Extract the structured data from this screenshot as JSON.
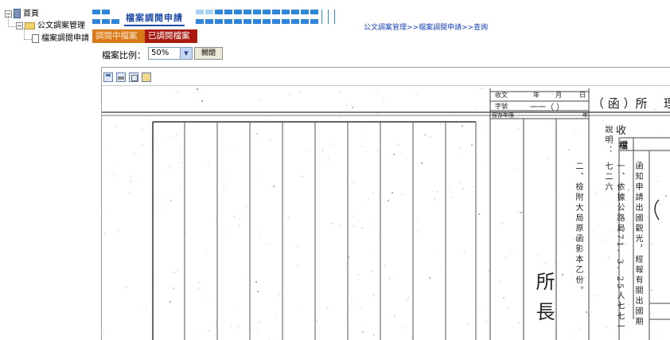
{
  "tree": {
    "home_label": "首頁",
    "archive_label": "公文調案管理",
    "request_label": "檔案調閱申請",
    "expand_symbol": "−"
  },
  "header": {
    "title": "檔案調閱申請",
    "breadcrumb": "公文調案管理>>檔案調閱申請>>查詢"
  },
  "tabs": [
    {
      "label": "調閱中檔案"
    },
    {
      "label": "已調閱檔案"
    }
  ],
  "toolbar": {
    "ratio_label": "檔案比例：",
    "ratio_value": "50%",
    "close_label": "關閉"
  },
  "viewer": {
    "tools": [
      "save-icon",
      "print-icon",
      "copy-icon",
      "open-icon"
    ]
  },
  "document": {
    "received_text": "收文",
    "year_text": "年",
    "month_text": "月",
    "day_text": "日",
    "word_text": "字號",
    "number_paren": "一一（  ）",
    "storage_text": "保存年限",
    "year_suffix": "年",
    "letter_type": "（  函  ）所",
    "handle_text": "理",
    "recv_label": "收",
    "main_label": "檔",
    "note_label": "說明：",
    "line1": "一、依據公路局71. 3. 25人七七一七二六",
    "line2": "二、檢附大局原函影本乙份。",
    "col_main": "函知申請出國觀光，經報有關出國期",
    "signature": "所長"
  },
  "colors": {
    "tab_active": "#d97a1a",
    "tab_done": "#a8190e",
    "title": "#1f4aa8",
    "link": "#1a44b8"
  }
}
